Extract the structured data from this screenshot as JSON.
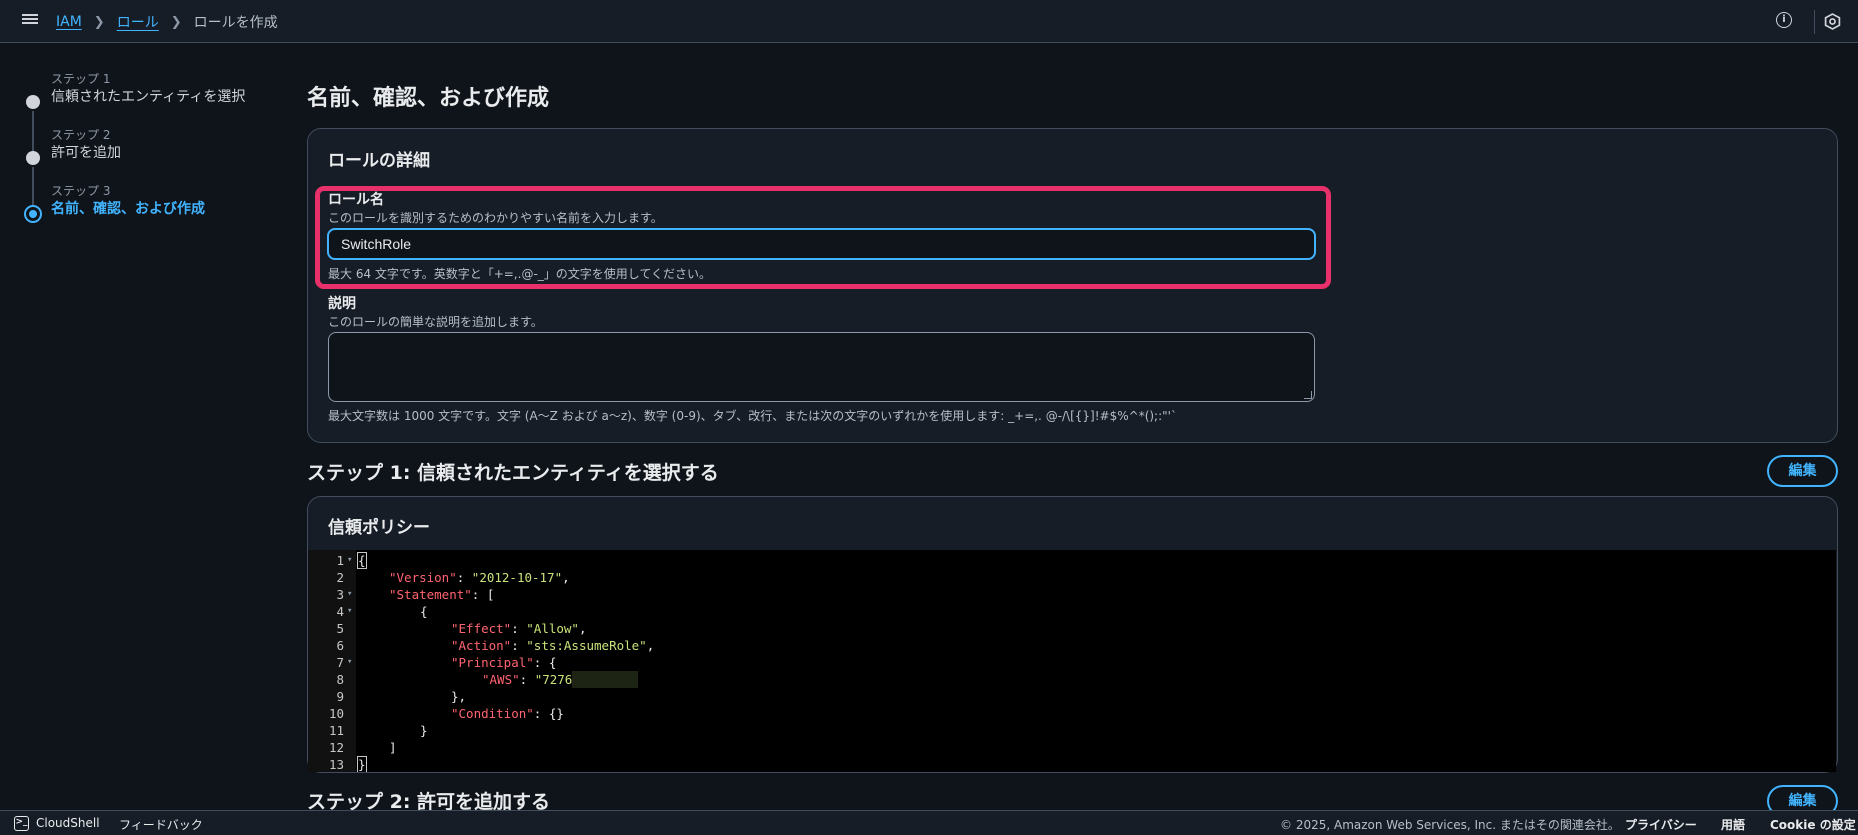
{
  "breadcrumb": {
    "items": [
      "IAM",
      "ロール"
    ],
    "current": "ロールを作成"
  },
  "steps": [
    {
      "num": "ステップ 1",
      "label": "信頼されたエンティティを選択"
    },
    {
      "num": "ステップ 2",
      "label": "許可を追加"
    },
    {
      "num": "ステップ 3",
      "label": "名前、確認、および作成"
    }
  ],
  "page_title": "名前、確認、および作成",
  "role_details": {
    "title": "ロールの詳細",
    "role_name": {
      "label": "ロール名",
      "desc": "このロールを識別するためのわかりやすい名前を入力します。",
      "value": "SwitchRole",
      "hint": "最大 64 文字です。英数字と「+=,.@-_」の文字を使用してください。"
    },
    "description": {
      "label": "説明",
      "desc": "このロールの簡単な説明を追加します。",
      "value": "",
      "hint": "最大文字数は 1000 文字です。文字 (A～Z および a～z)、数字 (0-9)、タブ、改行、または次の文字のいずれかを使用します: _+=,. @-/\\[{}]!#$%^*();:\"'`"
    }
  },
  "step1_section": {
    "title": "ステップ 1: 信頼されたエンティティを選択する",
    "edit_label": "編集"
  },
  "trust_policy": {
    "title": "信頼ポリシー",
    "lines": [
      {
        "n": "1",
        "text": "{"
      },
      {
        "n": "2",
        "key": "\"Version\"",
        "val": "\"2012-10-17\"",
        "end": ","
      },
      {
        "n": "3",
        "key": "\"Statement\"",
        "val": "[",
        "end": ""
      },
      {
        "n": "4",
        "text": "{"
      },
      {
        "n": "5",
        "key": "\"Effect\"",
        "val": "\"Allow\"",
        "end": ","
      },
      {
        "n": "6",
        "key": "\"Action\"",
        "val": "\"sts:AssumeRole\"",
        "end": ","
      },
      {
        "n": "7",
        "key": "\"Principal\"",
        "val": "{",
        "end": ""
      },
      {
        "n": "8",
        "key": "\"AWS\"",
        "val": "\"7276",
        "end": ""
      },
      {
        "n": "9",
        "text": "},"
      },
      {
        "n": "10",
        "key": "\"Condition\"",
        "val": "{}",
        "end": ""
      },
      {
        "n": "11",
        "text": "}"
      },
      {
        "n": "12",
        "text": "]"
      },
      {
        "n": "13",
        "text": "}"
      }
    ]
  },
  "step2_section": {
    "title": "ステップ 2: 許可を追加する",
    "edit_label": "編集"
  },
  "footer": {
    "cloudshell": "CloudShell",
    "feedback": "フィードバック",
    "copyright": "© 2025, Amazon Web Services, Inc. またはその関連会社。",
    "privacy": "プライバシー",
    "terms": "用語",
    "cookie": "Cookie の設定"
  },
  "colors": {
    "accent": "#42b4ff",
    "highlight": "#e8306a",
    "json_key": "#ff6470",
    "json_string": "#c8e27a"
  }
}
